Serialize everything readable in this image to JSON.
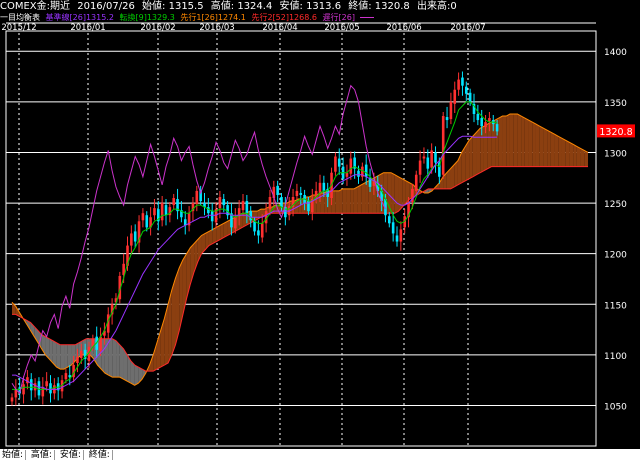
{
  "header": {
    "instrument": "COMEX金:期近",
    "date": "2016/07/26",
    "open": "始値: 1315.5",
    "high": "高値: 1324.4",
    "low": "安値: 1313.6",
    "close": "終値: 1320.8",
    "volume": "出来高:0"
  },
  "legend": {
    "title": "一目均衡表",
    "kijun": "基準線[26]1315.2",
    "tenkan": "転換[9]1329.3",
    "senkou1": "先行1[26]1274.1",
    "senkou2": "先行2[52]1268.6",
    "chikou": "遅行[26]",
    "colors": {
      "kijun": "#9933ff",
      "tenkan": "#00cc00",
      "senkou1": "#ff8800",
      "senkou2": "#ff2a2a",
      "chikou": "#cc33cc"
    }
  },
  "footer": {
    "open": "始値:",
    "high": "高値:",
    "low": "安値:",
    "close": "終値:"
  },
  "chart_data": {
    "type": "candlestick",
    "x_labels": [
      "2015/12",
      "2016/01",
      "2016/02",
      "2016/03",
      "2016/04",
      "2016/05",
      "2016/06",
      "2016/07"
    ],
    "y_ticks": [
      1050,
      1100,
      1150,
      1200,
      1250,
      1300,
      1350,
      1400
    ],
    "ylim": [
      1010,
      1420
    ],
    "last_price": "1320.8",
    "closes": [
      1058,
      1066,
      1062,
      1071,
      1078,
      1065,
      1072,
      1060,
      1068,
      1074,
      1062,
      1070,
      1065,
      1075,
      1082,
      1078,
      1090,
      1098,
      1104,
      1096,
      1108,
      1116,
      1105,
      1118,
      1124,
      1140,
      1150,
      1156,
      1178,
      1190,
      1208,
      1220,
      1212,
      1232,
      1240,
      1226,
      1236,
      1245,
      1232,
      1250,
      1238,
      1246,
      1255,
      1242,
      1236,
      1228,
      1240,
      1250,
      1262,
      1252,
      1246,
      1240,
      1232,
      1244,
      1256,
      1248,
      1238,
      1226,
      1236,
      1245,
      1252,
      1240,
      1233,
      1222,
      1218,
      1230,
      1242,
      1256,
      1266,
      1258,
      1246,
      1236,
      1247,
      1256,
      1262,
      1258,
      1250,
      1242,
      1254,
      1262,
      1270,
      1262,
      1256,
      1280,
      1296,
      1286,
      1274,
      1280,
      1294,
      1284,
      1276,
      1286,
      1276,
      1266,
      1272,
      1262,
      1252,
      1238,
      1230,
      1220,
      1212,
      1224,
      1237,
      1250,
      1264,
      1278,
      1292,
      1296,
      1284,
      1302,
      1290,
      1276,
      1336,
      1332,
      1350,
      1362,
      1372,
      1366,
      1358,
      1350,
      1338,
      1332,
      1326,
      1330,
      1334,
      1328,
      1320.8
    ],
    "tenkan": [
      1066,
      1066,
      1066,
      1068,
      1068,
      1068,
      1068,
      1066,
      1066,
      1066,
      1066,
      1068,
      1068,
      1070,
      1074,
      1076,
      1082,
      1088,
      1094,
      1098,
      1102,
      1108,
      1112,
      1118,
      1124,
      1134,
      1142,
      1150,
      1164,
      1176,
      1190,
      1200,
      1206,
      1214,
      1222,
      1224,
      1226,
      1232,
      1234,
      1238,
      1238,
      1240,
      1244,
      1244,
      1242,
      1240,
      1240,
      1244,
      1248,
      1248,
      1246,
      1244,
      1242,
      1242,
      1244,
      1244,
      1242,
      1238,
      1236,
      1238,
      1240,
      1240,
      1236,
      1232,
      1230,
      1230,
      1234,
      1240,
      1246,
      1248,
      1246,
      1244,
      1244,
      1248,
      1252,
      1254,
      1254,
      1252,
      1252,
      1256,
      1260,
      1262,
      1262,
      1268,
      1276,
      1280,
      1280,
      1280,
      1284,
      1286,
      1284,
      1282,
      1280,
      1276,
      1272,
      1268,
      1262,
      1254,
      1246,
      1238,
      1232,
      1230,
      1232,
      1238,
      1246,
      1256,
      1266,
      1274,
      1278,
      1284,
      1288,
      1286,
      1300,
      1310,
      1320,
      1330,
      1342,
      1346,
      1350,
      1350,
      1346,
      1340,
      1336,
      1332,
      1330,
      1330,
      1329.3
    ],
    "kijun": [
      1080,
      1080,
      1078,
      1076,
      1074,
      1072,
      1070,
      1068,
      1068,
      1066,
      1066,
      1066,
      1066,
      1068,
      1070,
      1072,
      1074,
      1078,
      1082,
      1086,
      1090,
      1094,
      1098,
      1102,
      1106,
      1112,
      1118,
      1124,
      1132,
      1140,
      1148,
      1156,
      1164,
      1172,
      1180,
      1186,
      1192,
      1198,
      1204,
      1208,
      1212,
      1216,
      1220,
      1224,
      1226,
      1228,
      1230,
      1232,
      1234,
      1236,
      1236,
      1238,
      1238,
      1238,
      1240,
      1240,
      1240,
      1238,
      1238,
      1238,
      1238,
      1238,
      1236,
      1236,
      1236,
      1236,
      1238,
      1240,
      1242,
      1242,
      1242,
      1242,
      1242,
      1244,
      1246,
      1248,
      1250,
      1250,
      1252,
      1254,
      1256,
      1258,
      1260,
      1262,
      1266,
      1270,
      1272,
      1274,
      1276,
      1278,
      1278,
      1278,
      1276,
      1274,
      1272,
      1270,
      1266,
      1262,
      1258,
      1254,
      1250,
      1248,
      1248,
      1250,
      1254,
      1258,
      1264,
      1270,
      1276,
      1282,
      1288,
      1292,
      1298,
      1302,
      1306,
      1310,
      1314,
      1316,
      1316,
      1316,
      1315,
      1315,
      1315,
      1315,
      1315,
      1315,
      1315.2
    ],
    "senkou_a": [
      1152,
      1148,
      1142,
      1136,
      1130,
      1124,
      1118,
      1112,
      1106,
      1100,
      1096,
      1092,
      1088,
      1086,
      1086,
      1088,
      1090,
      1094,
      1098,
      1100,
      1102,
      1100,
      1096,
      1090,
      1086,
      1082,
      1080,
      1078,
      1078,
      1078,
      1076,
      1074,
      1072,
      1070,
      1072,
      1076,
      1082,
      1090,
      1100,
      1112,
      1124,
      1136,
      1150,
      1164,
      1176,
      1186,
      1194,
      1200,
      1206,
      1210,
      1214,
      1218,
      1220,
      1222,
      1224,
      1226,
      1228,
      1230,
      1232,
      1234,
      1236,
      1238,
      1240,
      1240,
      1242,
      1242,
      1242,
      1244,
      1244,
      1246,
      1246,
      1248,
      1248,
      1250,
      1250,
      1252,
      1252,
      1254,
      1254,
      1256,
      1256,
      1258,
      1258,
      1260,
      1260,
      1262,
      1262,
      1262,
      1262,
      1264,
      1264,
      1264,
      1264,
      1266,
      1268,
      1270,
      1272,
      1274,
      1276,
      1278,
      1280,
      1280,
      1280,
      1278,
      1276,
      1274,
      1272,
      1270,
      1268,
      1264,
      1262,
      1260,
      1260,
      1262,
      1266,
      1270,
      1276,
      1280,
      1284,
      1288,
      1292,
      1300,
      1306,
      1312,
      1316,
      1320,
      1324,
      1326,
      1328,
      1330,
      1332,
      1334,
      1336,
      1336,
      1338,
      1338,
      1338,
      1336,
      1334,
      1332,
      1330,
      1328,
      1326,
      1324,
      1322,
      1320,
      1318,
      1316,
      1314,
      1312,
      1310,
      1308,
      1306,
      1304,
      1302,
      1300
    ],
    "senkou_b": [
      1140,
      1140,
      1138,
      1136,
      1134,
      1132,
      1128,
      1124,
      1120,
      1118,
      1116,
      1114,
      1112,
      1110,
      1110,
      1110,
      1110,
      1110,
      1112,
      1114,
      1116,
      1116,
      1116,
      1116,
      1116,
      1116,
      1116,
      1116,
      1114,
      1110,
      1106,
      1100,
      1094,
      1090,
      1088,
      1086,
      1084,
      1084,
      1084,
      1086,
      1088,
      1090,
      1092,
      1100,
      1110,
      1124,
      1140,
      1156,
      1170,
      1182,
      1192,
      1200,
      1204,
      1208,
      1210,
      1212,
      1214,
      1216,
      1218,
      1220,
      1222,
      1224,
      1226,
      1228,
      1230,
      1232,
      1234,
      1236,
      1238,
      1240,
      1240,
      1240,
      1240,
      1240,
      1240,
      1240,
      1240,
      1240,
      1240,
      1240,
      1240,
      1240,
      1240,
      1240,
      1240,
      1240,
      1240,
      1240,
      1240,
      1240,
      1240,
      1240,
      1240,
      1240,
      1240,
      1240,
      1240,
      1240,
      1240,
      1240,
      1240,
      1240,
      1240,
      1240,
      1242,
      1246,
      1250,
      1254,
      1256,
      1258,
      1260,
      1262,
      1264,
      1264,
      1264,
      1264,
      1264,
      1264,
      1264,
      1266,
      1268,
      1270,
      1272,
      1274,
      1276,
      1278,
      1280,
      1282,
      1284,
      1286,
      1286,
      1286,
      1286,
      1286,
      1286,
      1286,
      1286,
      1286,
      1286,
      1286,
      1286,
      1286,
      1286,
      1286,
      1286,
      1286,
      1286,
      1286,
      1286,
      1286,
      1286,
      1286,
      1286,
      1286,
      1286,
      1286
    ],
    "chikou": [
      1072,
      1066,
      1062,
      1078,
      1090,
      1100,
      1094,
      1110,
      1124,
      1118,
      1132,
      1140,
      1126,
      1148,
      1158,
      1146,
      1170,
      1182,
      1196,
      1212,
      1226,
      1244,
      1262,
      1276,
      1290,
      1302,
      1282,
      1266,
      1256,
      1248,
      1268,
      1282,
      1296,
      1288,
      1276,
      1292,
      1308,
      1296,
      1282,
      1268,
      1286,
      1298,
      1314,
      1306,
      1292,
      1300,
      1306,
      1288,
      1272,
      1260,
      1270,
      1284,
      1296,
      1310,
      1302,
      1290,
      1284,
      1298,
      1312,
      1304,
      1292,
      1298,
      1310,
      1320,
      1302,
      1288,
      1276,
      1266,
      1256,
      1244,
      1236,
      1248,
      1262,
      1276,
      1290,
      1302,
      1316,
      1306,
      1298,
      1312,
      1326,
      1316,
      1304,
      1314,
      1326,
      1318,
      1338,
      1352,
      1366,
      1362,
      1350,
      1328,
      1306,
      1290,
      1276,
      1260,
      1252,
      1244
    ]
  }
}
